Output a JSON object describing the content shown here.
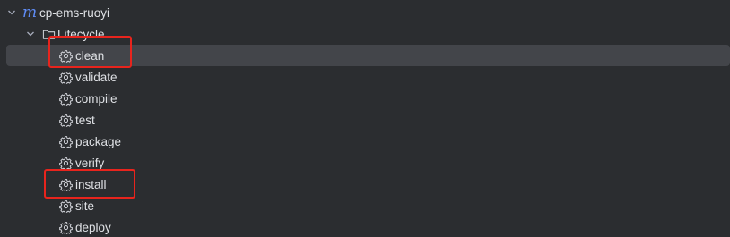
{
  "project": {
    "name": "cp-ems-ruoyi",
    "icon": "maven-m-icon",
    "icon_glyph": "m",
    "expanded": true
  },
  "lifecycle": {
    "label": "Lifecycle",
    "icon": "folder-icon",
    "expanded": true,
    "goals": [
      {
        "label": "clean",
        "icon": "gear-icon",
        "selected": true,
        "highlighted": true
      },
      {
        "label": "validate",
        "icon": "gear-icon"
      },
      {
        "label": "compile",
        "icon": "gear-icon"
      },
      {
        "label": "test",
        "icon": "gear-icon"
      },
      {
        "label": "package",
        "icon": "gear-icon"
      },
      {
        "label": "verify",
        "icon": "gear-icon"
      },
      {
        "label": "install",
        "icon": "gear-icon",
        "highlighted": true
      },
      {
        "label": "site",
        "icon": "gear-icon"
      },
      {
        "label": "deploy",
        "icon": "gear-icon"
      }
    ]
  },
  "colors": {
    "background": "#2b2d30",
    "selection": "#43454a",
    "text": "#dfe1e5",
    "maven_accent": "#5f8cf5",
    "highlight_box": "#e8241d"
  }
}
